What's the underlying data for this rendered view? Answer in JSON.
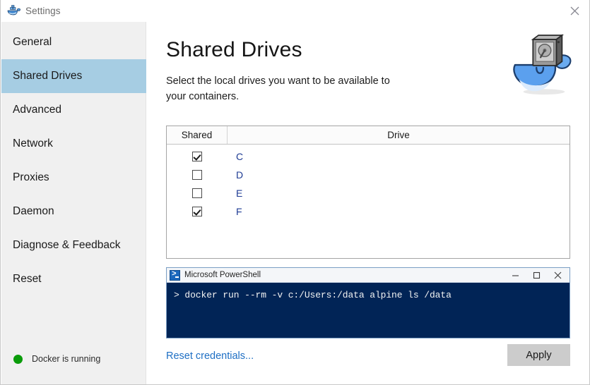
{
  "window": {
    "title": "Settings",
    "app_icon": "docker-whale-icon",
    "close_label": "✕"
  },
  "sidebar": {
    "items": [
      {
        "label": "General",
        "selected": false
      },
      {
        "label": "Shared Drives",
        "selected": true
      },
      {
        "label": "Advanced",
        "selected": false
      },
      {
        "label": "Network",
        "selected": false
      },
      {
        "label": "Proxies",
        "selected": false
      },
      {
        "label": "Daemon",
        "selected": false
      },
      {
        "label": "Diagnose & Feedback",
        "selected": false
      },
      {
        "label": "Reset",
        "selected": false
      }
    ],
    "status": {
      "text": "Docker is running",
      "dot_color": "#0a9c0a"
    }
  },
  "main": {
    "title": "Shared Drives",
    "description": "Select the local drives you want to be available to your containers.",
    "logo_icon": "docker-whale-with-harddrive-icon",
    "drives_table": {
      "columns": [
        "Shared",
        "Drive"
      ],
      "rows": [
        {
          "drive": "C",
          "shared": true
        },
        {
          "drive": "D",
          "shared": false
        },
        {
          "drive": "E",
          "shared": false
        },
        {
          "drive": "F",
          "shared": true
        }
      ]
    },
    "terminal": {
      "title": "Microsoft PowerShell",
      "icon": "powershell-icon",
      "minimize_label": "—",
      "maximize_label": "☐",
      "close_label": "✕",
      "lines": [
        "> docker run --rm -v c:/Users:/data alpine ls /data"
      ]
    },
    "reset_credentials_label": "Reset credentials...",
    "apply_label": "Apply"
  },
  "colors": {
    "sidebar_bg": "#f0f0f0",
    "selection": "#a6cde3",
    "link": "#1e6fc4",
    "drive_text": "#1f3c94",
    "terminal_bg": "#012456",
    "apply_bg": "#cccccc"
  }
}
